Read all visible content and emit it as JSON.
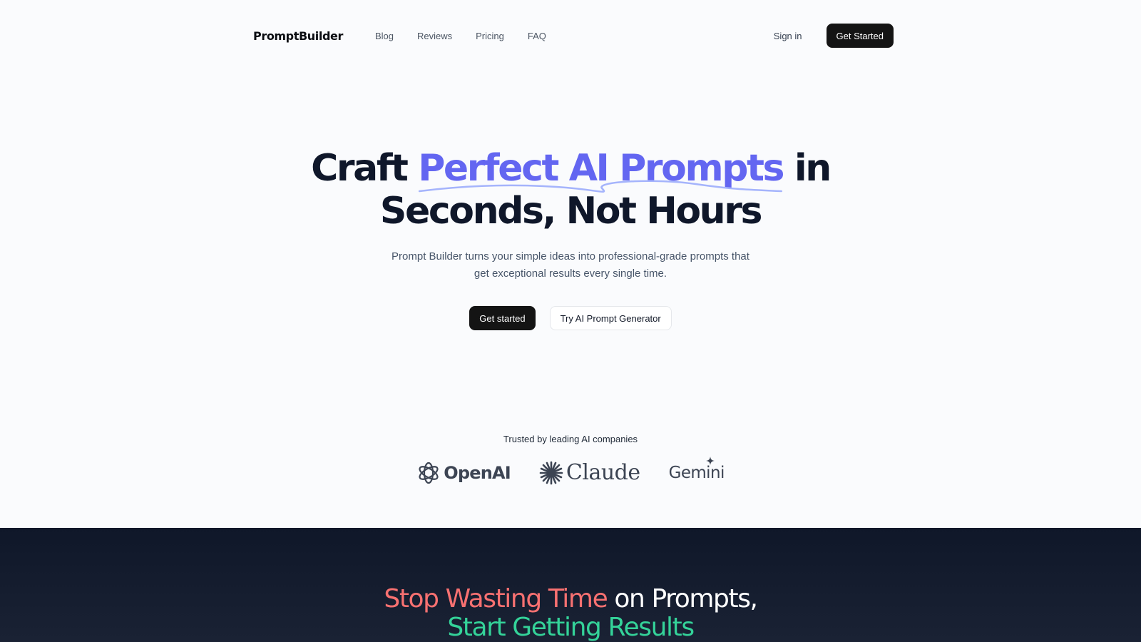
{
  "nav": {
    "brand": "PromptBuilder",
    "links": [
      "Blog",
      "Reviews",
      "Pricing",
      "FAQ"
    ],
    "sign_in": "Sign in",
    "cta": "Get Started"
  },
  "hero": {
    "title_pre": "Craft ",
    "title_accent": "Perfect AI Prompts",
    "title_post_line1": " in",
    "title_line2": "Seconds, Not Hours",
    "subtitle": "Prompt Builder turns your simple ideas into professional-grade prompts that get exceptional results every single time.",
    "primary_cta": "Get started",
    "secondary_cta": "Try AI Prompt Generator"
  },
  "trusted": {
    "label": "Trusted by leading AI companies",
    "logos": [
      {
        "name": "OpenAI",
        "icon": "openai-knot-icon"
      },
      {
        "name": "Claude",
        "icon": "claude-starburst-icon"
      },
      {
        "name": "Gemini",
        "icon": "gemini-spark-icon"
      }
    ]
  },
  "section2": {
    "title_red": "Stop Wasting Time",
    "title_white": " on Prompts,",
    "title_green": "Start Getting Results"
  },
  "colors": {
    "accent": "#6366f1",
    "dark_bg": "#0f1729",
    "red": "#f87171",
    "green": "#34d399"
  }
}
